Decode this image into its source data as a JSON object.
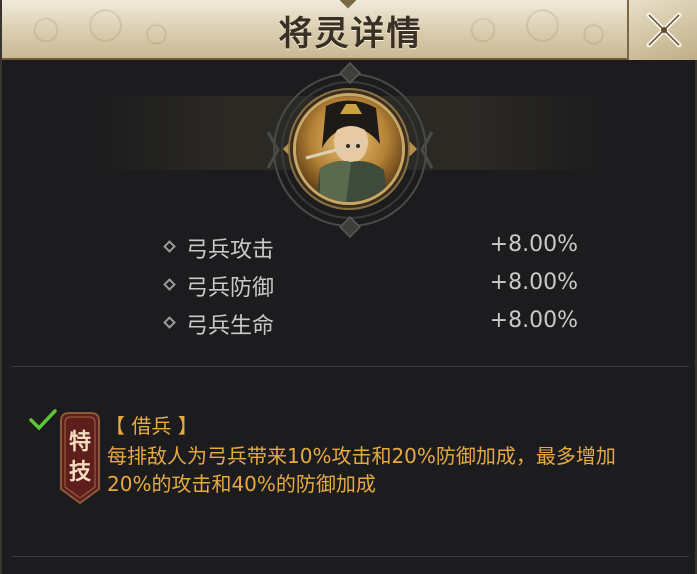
{
  "title": "将灵详情",
  "close_icon": "close-crossed-swords-icon",
  "portrait": {
    "icon": "general-portrait"
  },
  "stats": [
    {
      "name": "弓兵攻击",
      "value": "+8.00%"
    },
    {
      "name": "弓兵防御",
      "value": "+8.00%"
    },
    {
      "name": "弓兵生命",
      "value": "+8.00%"
    }
  ],
  "skill": {
    "badge_top": "特",
    "badge_bottom": "技",
    "name": "【 借兵 】",
    "description": "每排敌人为弓兵带来10%攻击和20%防御加成，最多增加20%的攻击和40%的防御加成",
    "active": true
  },
  "colors": {
    "skill_text": "#e6a93f",
    "stat_text": "#c9c9c9",
    "check": "#5fc33a"
  }
}
